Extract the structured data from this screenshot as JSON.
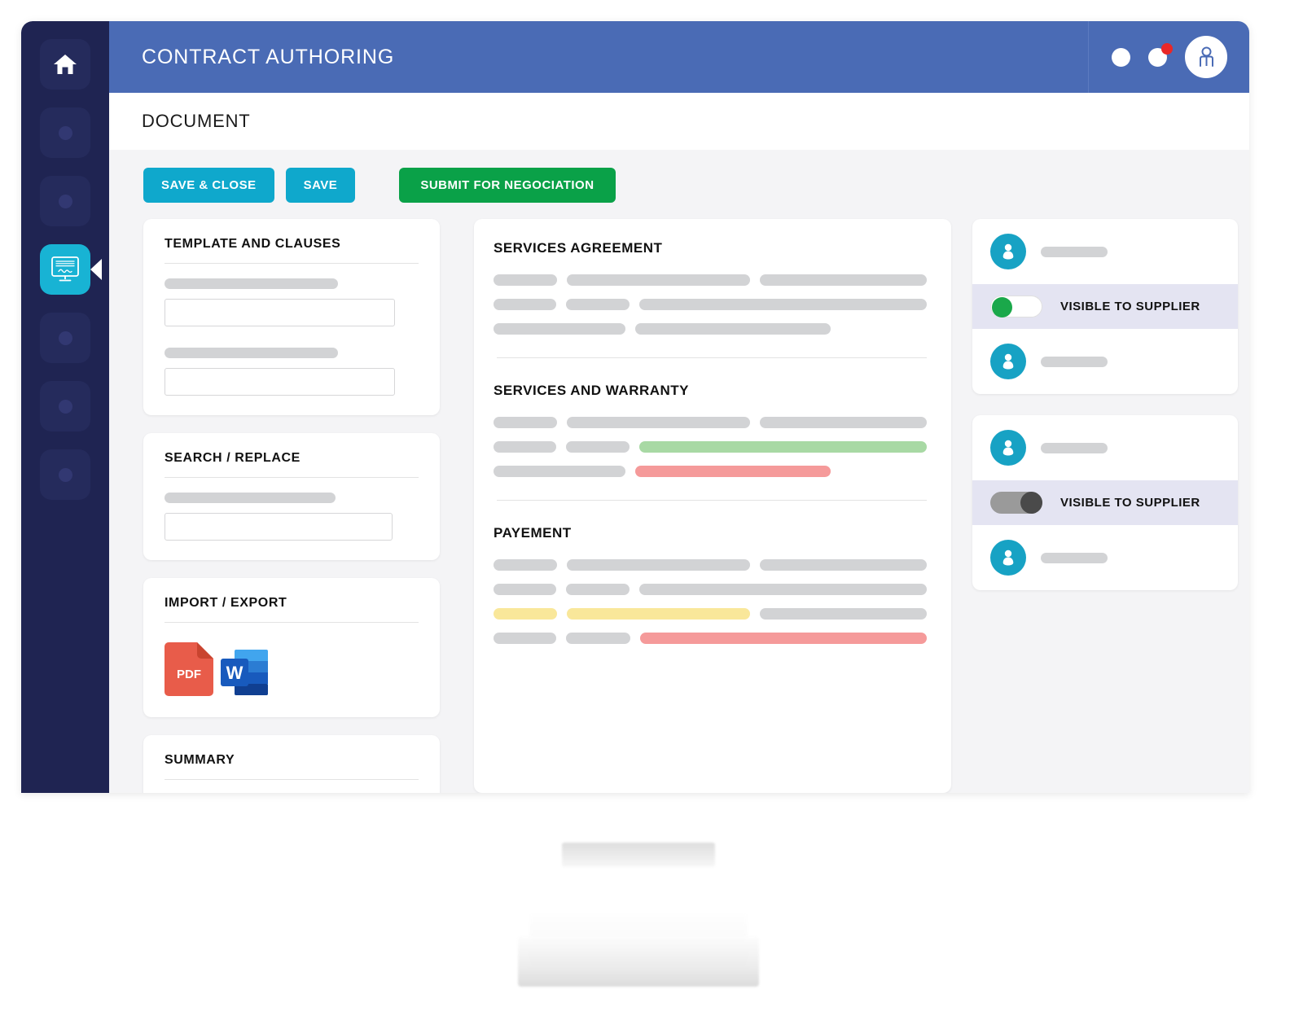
{
  "app": {
    "header_title": "CONTRACT AUTHORING",
    "page_title": "DOCUMENT"
  },
  "header_icons": {
    "dot1": "circle-icon",
    "dot2": "notification-circle-icon",
    "badge": "red-badge-dot",
    "avatar": "user-avatar-icon"
  },
  "rail": {
    "items": [
      {
        "name": "home",
        "icon": "home-icon",
        "active": false
      },
      {
        "name": "nav-2",
        "icon": "dot-placeholder-icon",
        "active": false
      },
      {
        "name": "nav-3",
        "icon": "dot-placeholder-icon",
        "active": false
      },
      {
        "name": "contract-authoring",
        "icon": "contract-screen-icon",
        "active": true
      },
      {
        "name": "nav-5",
        "icon": "dot-placeholder-icon",
        "active": false
      },
      {
        "name": "nav-6",
        "icon": "dot-placeholder-icon",
        "active": false
      },
      {
        "name": "nav-7",
        "icon": "dot-placeholder-icon",
        "active": false
      }
    ]
  },
  "toolbar": {
    "save_close_label": "SAVE & CLOSE",
    "save_label": "SAVE",
    "submit_label": "SUBMIT FOR NEGOCIATION"
  },
  "left_panels": {
    "template_and_clauses": {
      "title": "TEMPLATE AND CLAUSES",
      "field1_value": "",
      "field2_value": ""
    },
    "search_replace": {
      "title": "SEARCH / REPLACE",
      "field_value": ""
    },
    "import_export": {
      "title": "IMPORT / EXPORT",
      "pdf_label": "PDF",
      "word_label": "W"
    },
    "summary": {
      "title": "SUMMARY"
    }
  },
  "document": {
    "sections": [
      {
        "title": "SERVICES AGREEMENT"
      },
      {
        "title": "SERVICES AND WARRANTY"
      },
      {
        "title": "PAYEMENT"
      }
    ]
  },
  "right_panel": {
    "cards": [
      {
        "toggle_label": "VISIBLE TO SUPPLIER",
        "toggle_state": "on"
      },
      {
        "toggle_label": "VISIBLE TO SUPPLIER",
        "toggle_state": "off"
      }
    ]
  },
  "colors": {
    "rail_bg": "#1f2452",
    "topbar_bg": "#4a6bb5",
    "accent_teal": "#0fa8cc",
    "accent_green": "#0aa148",
    "active_nav": "#18b3d4",
    "avatar_cyan": "#17a2c4",
    "toggle_on": "#1aa84a",
    "toggle_off": "#4a4a4a",
    "bar_green": "#a8d9a4",
    "bar_red": "#f59a9a",
    "bar_yellow": "#f9e79a",
    "bar_gray": "#d2d3d5",
    "badge_red": "#ea2727",
    "toggle_row_bg": "#e4e4f2"
  }
}
